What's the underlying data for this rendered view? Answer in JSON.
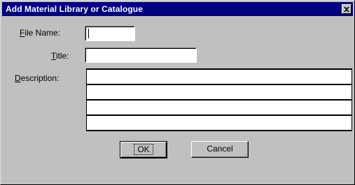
{
  "window": {
    "title": "Add Material Library or Catalogue",
    "close_glyph": "X"
  },
  "form": {
    "file_name": {
      "label_mnemonic": "F",
      "label_rest": "ile Name:",
      "value": ""
    },
    "title": {
      "label_mnemonic": "T",
      "label_rest": "itle:",
      "value": ""
    },
    "description": {
      "label_mnemonic": "D",
      "label_rest": "escription:",
      "lines": [
        "",
        "",
        "",
        ""
      ]
    }
  },
  "buttons": {
    "ok_label": "OK",
    "cancel_label": "Cancel"
  },
  "colors": {
    "titlebar": "#000080",
    "face": "#c0c0c0"
  }
}
